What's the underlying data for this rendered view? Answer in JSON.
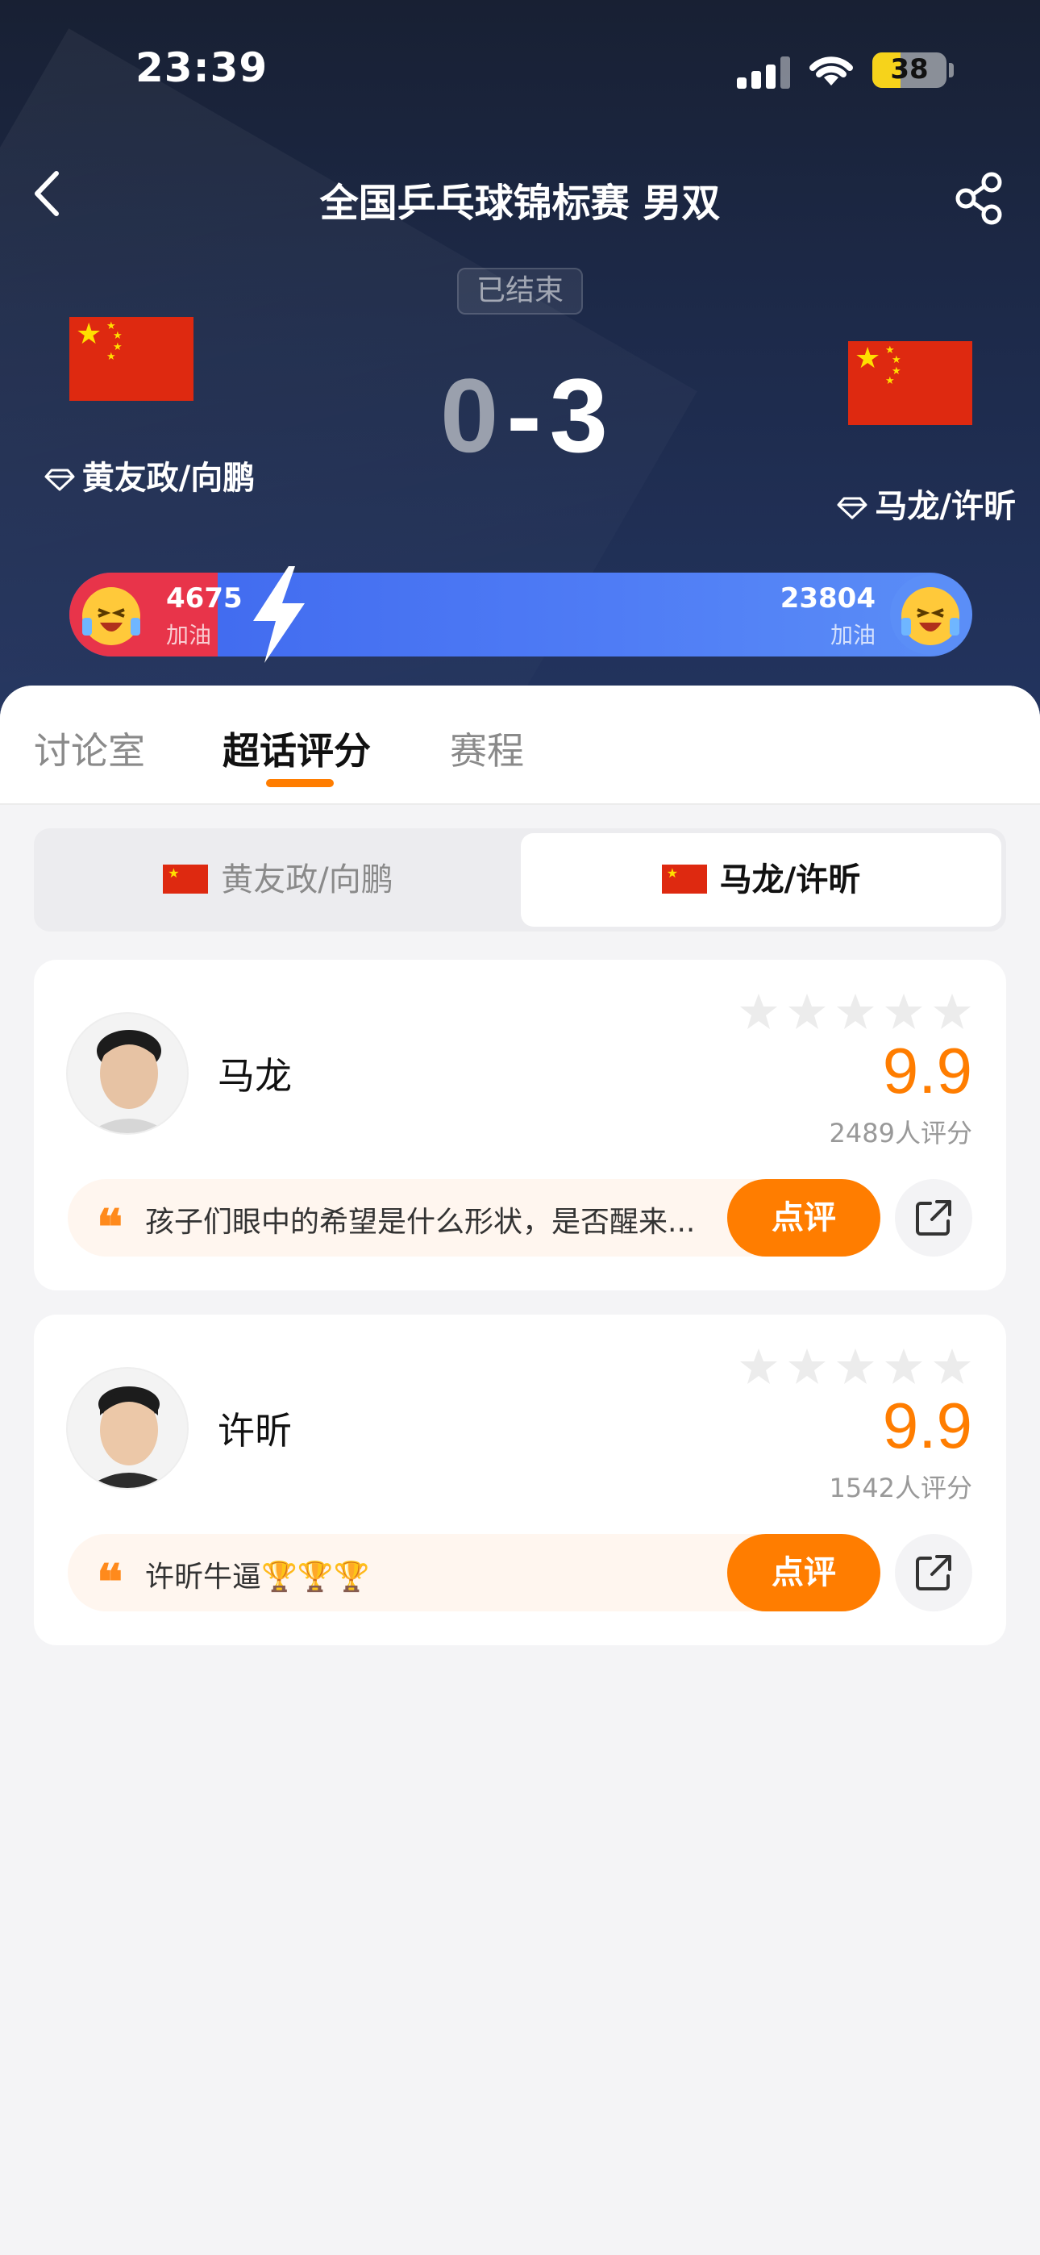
{
  "status_bar": {
    "time": "23:39",
    "battery": "38",
    "battery_level": 0.38
  },
  "header": {
    "title": "全国乒乓球锦标赛 男双"
  },
  "match": {
    "status": "已结束",
    "home_score": "0",
    "separator": "-",
    "away_score": "3",
    "home_team": "黄友政/向鹏",
    "away_team": "马龙/许昕"
  },
  "cheer": {
    "home_count": "4675",
    "home_label": "加油",
    "away_count": "23804",
    "away_label": "加油",
    "home_share": 0.164
  },
  "tabs": [
    {
      "label": "讨论室"
    },
    {
      "label": "超话评分"
    },
    {
      "label": "赛程"
    }
  ],
  "segment": {
    "home": "黄友政/向鹏",
    "away": "马龙/许昕"
  },
  "players": [
    {
      "name": "马龙",
      "rating": "9.9",
      "rating_count": "2489人评分",
      "comment": "孩子们眼中的希望是什么形状，是否醒来...",
      "review_label": "点评"
    },
    {
      "name": "许昕",
      "rating": "9.9",
      "rating_count": "1542人评分",
      "comment": "许昕牛逼🏆🏆🏆",
      "review_label": "点评"
    }
  ],
  "colors": {
    "accent": "#ff7d00",
    "home_cheer": "#e8344a",
    "away_cheer": "#4f7cf5",
    "flag_red": "#de2910",
    "flag_yellow": "#ffde00"
  },
  "icons": [
    "back-icon",
    "share-icon",
    "diamond-icon",
    "quote-icon",
    "external-share-icon",
    "star-icon",
    "lightning-icon",
    "cheer-emoji-icon"
  ]
}
